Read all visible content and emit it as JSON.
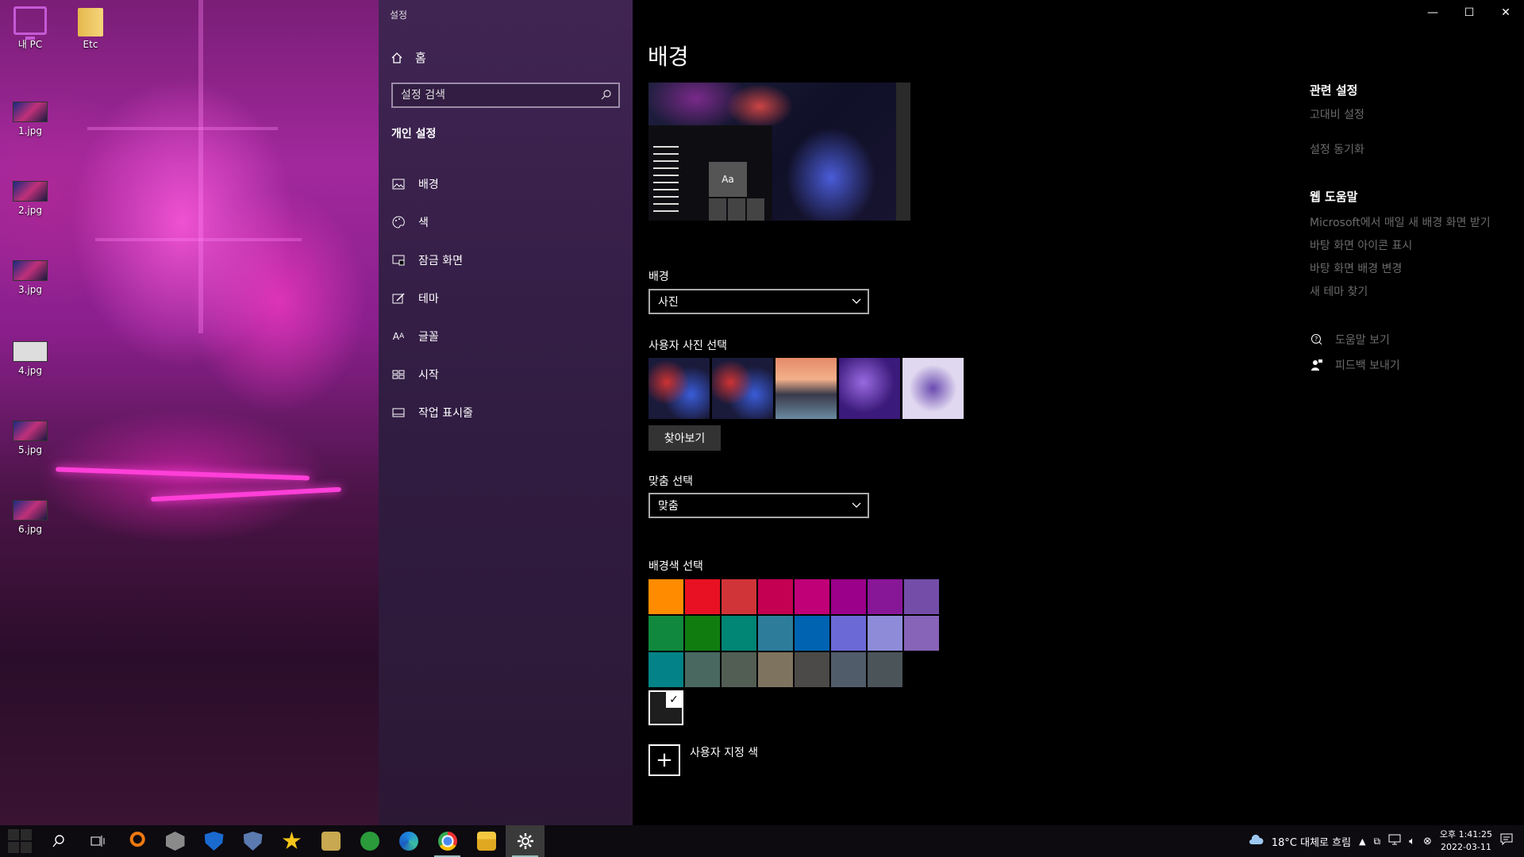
{
  "desktop": {
    "icons": [
      {
        "label": "내 PC"
      },
      {
        "label": "Etc"
      },
      {
        "label": "1.jpg"
      },
      {
        "label": "2.jpg"
      },
      {
        "label": "3.jpg"
      },
      {
        "label": "4.jpg"
      },
      {
        "label": "5.jpg"
      },
      {
        "label": "6.jpg"
      }
    ]
  },
  "window": {
    "title": "설정",
    "controls": {
      "minimize": "—",
      "maximize": "☐",
      "close": "✕"
    }
  },
  "nav": {
    "home_label": "홈",
    "search_placeholder": "설정 검색",
    "section_heading": "개인 설정",
    "items": [
      {
        "label": "배경",
        "icon": "image-icon"
      },
      {
        "label": "색",
        "icon": "palette-icon"
      },
      {
        "label": "잠금 화면",
        "icon": "lock-screen-icon"
      },
      {
        "label": "테마",
        "icon": "brush-icon"
      },
      {
        "label": "글꼴",
        "icon": "font-icon"
      },
      {
        "label": "시작",
        "icon": "start-icon"
      },
      {
        "label": "작업 표시줄",
        "icon": "taskbar-icon"
      }
    ]
  },
  "content": {
    "page_title": "배경",
    "preview": {
      "sample_text": "Aa"
    },
    "background_label": "배경",
    "background_value": "사진",
    "choose_picture_label": "사용자 사진 선택",
    "browse_button": "찾아보기",
    "fit_label": "맞춤 선택",
    "fit_value": "맞춤",
    "bg_color_label": "배경색 선택",
    "custom_color_label": "사용자 지정 색",
    "swatch_colors": [
      "#ff8c00",
      "#e81123",
      "#d13438",
      "#c30052",
      "#bf0077",
      "#9a0089",
      "#881798",
      "#744da9",
      "#10893e",
      "#107c10",
      "#018574",
      "#2d7d9a",
      "#0063b1",
      "#6b69d6",
      "#8e8cd8",
      "#8764b8",
      "#038387",
      "#486860",
      "#525e54",
      "#7e735f",
      "#4c4a48",
      "#515c6b",
      "#4a5459"
    ],
    "selected_color": "#1e1e1e",
    "accent": "#1e1e1e"
  },
  "related": {
    "heading": "관련 설정",
    "links": [
      "고대비 설정",
      "설정 동기화"
    ]
  },
  "web_help": {
    "heading": "웹 도움말",
    "links": [
      "Microsoft에서 매일 새 배경 화면 받기",
      "바탕 화면 아이콘 표시",
      "바탕 화면 배경 변경",
      "새 테마 찾기"
    ]
  },
  "help": {
    "get_help": "도움말 보기",
    "feedback": "피드백 보내기"
  },
  "taskbar": {
    "weather": "18°C  대체로 흐림",
    "time": "오후 1:41:25",
    "date": "2022-03-11"
  }
}
